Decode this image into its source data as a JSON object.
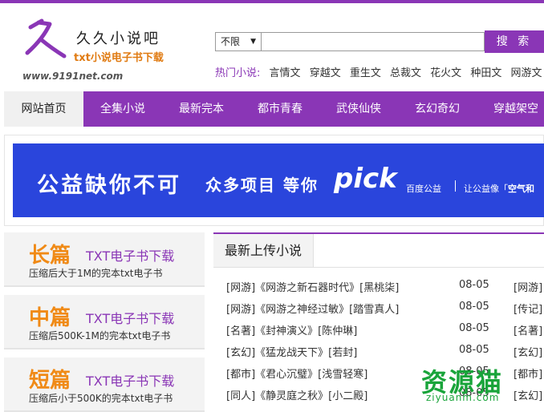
{
  "header": {
    "logo_name": "久久小说吧",
    "logo_sub": "txt小说电子书下载",
    "logo_url": "www.9191net.com"
  },
  "search": {
    "select_value": "不限",
    "button_label": "搜 索",
    "input_value": ""
  },
  "hot": {
    "label": "热门小说:",
    "items": [
      "言情文",
      "穿越文",
      "重生文",
      "总裁文",
      "花火文",
      "种田文",
      "网游文"
    ]
  },
  "nav": {
    "items": [
      "网站首页",
      "全集小说",
      "最新完本",
      "都市青春",
      "武侠仙侠",
      "玄幻奇幻",
      "穿越架空"
    ]
  },
  "banner": {
    "main": "公益缺你不可",
    "mid": "众多项目 等你",
    "pick": "pick",
    "brand": "百度公益",
    "slogan": "让公益像",
    "slogan_extra": "空气和"
  },
  "categories": [
    {
      "title": "长篇",
      "sub": "TXT电子书下载",
      "desc": "压缩后大于1M的完本txt电子书"
    },
    {
      "title": "中篇",
      "sub": "TXT电子书下载",
      "desc": "压缩后500K-1M的完本txt电子书"
    },
    {
      "title": "短篇",
      "sub": "TXT电子书下载",
      "desc": "压缩后小于500K的完本txt电子书"
    }
  ],
  "latest": {
    "title": "最新上传小说",
    "rows": [
      {
        "genre": "[网游]",
        "book": "《网游之新石器时代》",
        "author": "[黑桃柒]",
        "date": "08-05",
        "tag": "[网游]"
      },
      {
        "genre": "[网游]",
        "book": "《网游之神经过敏》",
        "author": "[踏雪真人]",
        "date": "08-05",
        "tag": "[传记]"
      },
      {
        "genre": "[名著]",
        "book": "《封神演义》",
        "author": "[陈仲琳]",
        "date": "08-05",
        "tag": "[名著]"
      },
      {
        "genre": "[玄幻]",
        "book": "《猛龙战天下》",
        "author": "[若封]",
        "date": "08-05",
        "tag": "[玄幻]"
      },
      {
        "genre": "[都市]",
        "book": "《君心沉璧》",
        "author": "[浅雪轻寒]",
        "date": "08-05",
        "tag": "[都市]"
      },
      {
        "genre": "[同人]",
        "book": "《静灵庭之秋》",
        "author": "[小二殿]",
        "date": "08-05",
        "tag": "[玄幻]"
      }
    ]
  },
  "watermark": {
    "text": "资源猫",
    "url": "ziyuanm.com"
  },
  "colors": {
    "brand": "#8a36b6",
    "accent": "#f08a16",
    "banner_bg": "#2a45dc",
    "watermark": "#19a43a"
  }
}
